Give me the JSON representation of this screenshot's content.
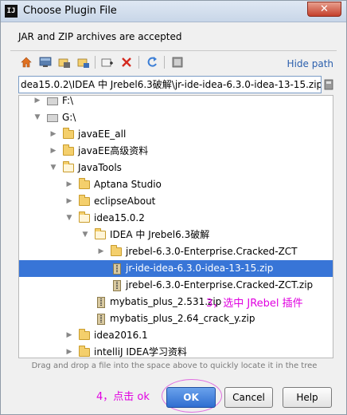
{
  "window": {
    "title": "Choose Plugin File",
    "app_icon_text": "IJ",
    "close_glyph": "✕"
  },
  "description": "JAR and ZIP archives are accepted",
  "toolbar": {
    "icons": [
      "home-icon",
      "desktop-icon",
      "project-icon",
      "module-icon",
      "new-folder-icon",
      "delete-icon",
      "refresh-icon",
      "show-hidden-icon"
    ],
    "hide_path_label": "Hide path"
  },
  "path_field": {
    "value": "dea15.0.2\\IDEA 中 Jrebel6.3破解\\jr-ide-idea-6.3.0-idea-13-15.zip"
  },
  "tree": {
    "rows": [
      {
        "label": "F:\\",
        "type": "drive",
        "arrow": "▶",
        "selected": false
      },
      {
        "label": "G:\\",
        "type": "drive",
        "arrow": "▼",
        "selected": false
      },
      {
        "label": "javaEE_all",
        "type": "folder",
        "arrow": "▶",
        "selected": false
      },
      {
        "label": "javaEE高级资料",
        "type": "folder",
        "arrow": "▶",
        "selected": false
      },
      {
        "label": "JavaTools",
        "type": "folder",
        "arrow": "▼",
        "selected": false
      },
      {
        "label": "Aptana Studio",
        "type": "folder",
        "arrow": "▶",
        "selected": false
      },
      {
        "label": "eclipseAbout",
        "type": "folder",
        "arrow": "▶",
        "selected": false
      },
      {
        "label": "idea15.0.2",
        "type": "folder",
        "arrow": "▼",
        "selected": false
      },
      {
        "label": "IDEA 中 Jrebel6.3破解",
        "type": "folder",
        "arrow": "▼",
        "selected": false
      },
      {
        "label": "jrebel-6.3.0-Enterprise.Cracked-ZCT",
        "type": "folder",
        "arrow": "▶",
        "selected": false
      },
      {
        "label": "jr-ide-idea-6.3.0-idea-13-15.zip",
        "type": "zip",
        "arrow": "",
        "selected": true
      },
      {
        "label": "jrebel-6.3.0-Enterprise.Cracked-ZCT.zip",
        "type": "zip",
        "arrow": "",
        "selected": false
      },
      {
        "label": "mybatis_plus_2.531.zip",
        "type": "zip",
        "arrow": "",
        "selected": false
      },
      {
        "label": "mybatis_plus_2.64_crack_y.zip",
        "type": "zip",
        "arrow": "",
        "selected": false
      },
      {
        "label": "idea2016.1",
        "type": "folder",
        "arrow": "▶",
        "selected": false
      },
      {
        "label": "intelliJ IDEA学习资料",
        "type": "folder",
        "arrow": "▶",
        "selected": false
      }
    ]
  },
  "annotations": {
    "step3": "3，选中 JRebel 插件",
    "step4": "4，点击 ok"
  },
  "hint": "Drag and drop a file into the space above to quickly locate it in the tree",
  "buttons": {
    "ok": "OK",
    "cancel": "Cancel",
    "help": "Help"
  },
  "colors": {
    "selection": "#3875d7",
    "annotation": "#e000e0",
    "link": "#2b5fad"
  }
}
